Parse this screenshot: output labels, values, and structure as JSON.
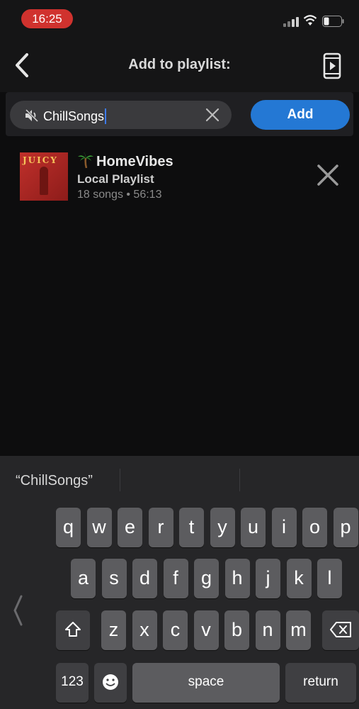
{
  "status_bar": {
    "time": "16:25"
  },
  "header": {
    "title": "Add to playlist:"
  },
  "search": {
    "value": "ChillSongs",
    "add_label": "Add"
  },
  "playlist": {
    "name": "HomeVibes",
    "type": "Local Playlist",
    "meta": "18 songs • 56:13",
    "art_text": "JUICY"
  },
  "keyboard": {
    "suggestion": "“ChillSongs”",
    "row1": [
      "q",
      "w",
      "e",
      "r",
      "t",
      "y",
      "u",
      "i",
      "o",
      "p"
    ],
    "row2": [
      "a",
      "s",
      "d",
      "f",
      "g",
      "h",
      "j",
      "k",
      "l"
    ],
    "row3": [
      "z",
      "x",
      "c",
      "v",
      "b",
      "n",
      "m"
    ],
    "numbers_label": "123",
    "space_label": "space",
    "return_label": "return"
  },
  "colors": {
    "accent": "#2478d4",
    "time_pill": "#d0322e",
    "background": "#0d0d0e"
  },
  "icons": [
    "back-chevron-icon",
    "device-icon",
    "speaker-icon",
    "clear-icon",
    "palm-tree-icon",
    "close-icon",
    "shift-icon",
    "backspace-icon",
    "emoji-icon"
  ]
}
